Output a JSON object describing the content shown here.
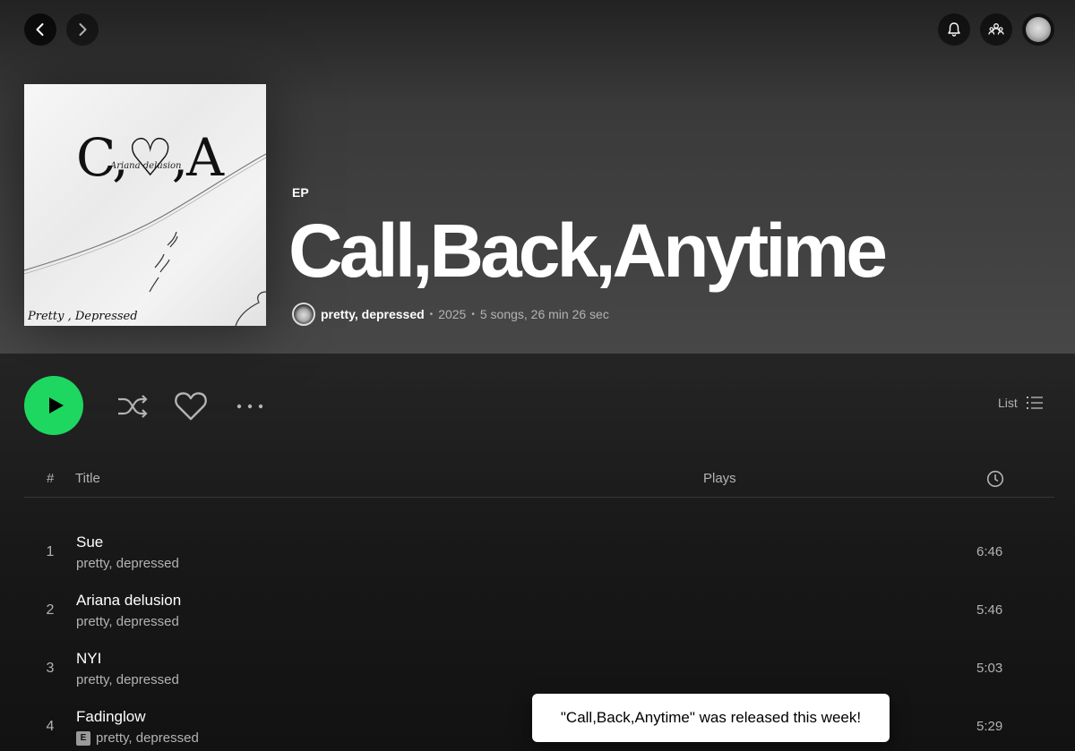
{
  "nav": {
    "back_icon": "chevron-left-icon",
    "forward_icon": "chevron-right-icon",
    "notifications_icon": "bell-icon",
    "friends_icon": "friends-activity-icon"
  },
  "album": {
    "cover": {
      "title_text": "C,♡,A",
      "subtitle_text": "Ariana delusion",
      "artist_text": "Pretty , Depressed"
    },
    "type": "EP",
    "title": "Call,Back,Anytime",
    "artist": "pretty, depressed",
    "year": "2025",
    "summary": "5 songs, 26 min 26 sec"
  },
  "controls": {
    "view_label": "List"
  },
  "table": {
    "headers": {
      "num": "#",
      "title": "Title",
      "plays": "Plays"
    },
    "tracks": [
      {
        "num": "1",
        "title": "Sue",
        "artist": "pretty, depressed",
        "duration": "6:46",
        "explicit": false
      },
      {
        "num": "2",
        "title": "Ariana delusion",
        "artist": "pretty, depressed",
        "duration": "5:46",
        "explicit": false
      },
      {
        "num": "3",
        "title": "NYI",
        "artist": "pretty, depressed",
        "duration": "5:03",
        "explicit": false
      },
      {
        "num": "4",
        "title": "Fadinglow",
        "artist": "pretty, depressed",
        "duration": "5:29",
        "explicit": true,
        "explicit_label": "E"
      }
    ]
  },
  "toast": {
    "message": "\"Call,Back,Anytime\" was released this week!"
  },
  "colors": {
    "accent": "#1ed760",
    "background": "#121212",
    "secondary_text": "#b3b3b3"
  }
}
